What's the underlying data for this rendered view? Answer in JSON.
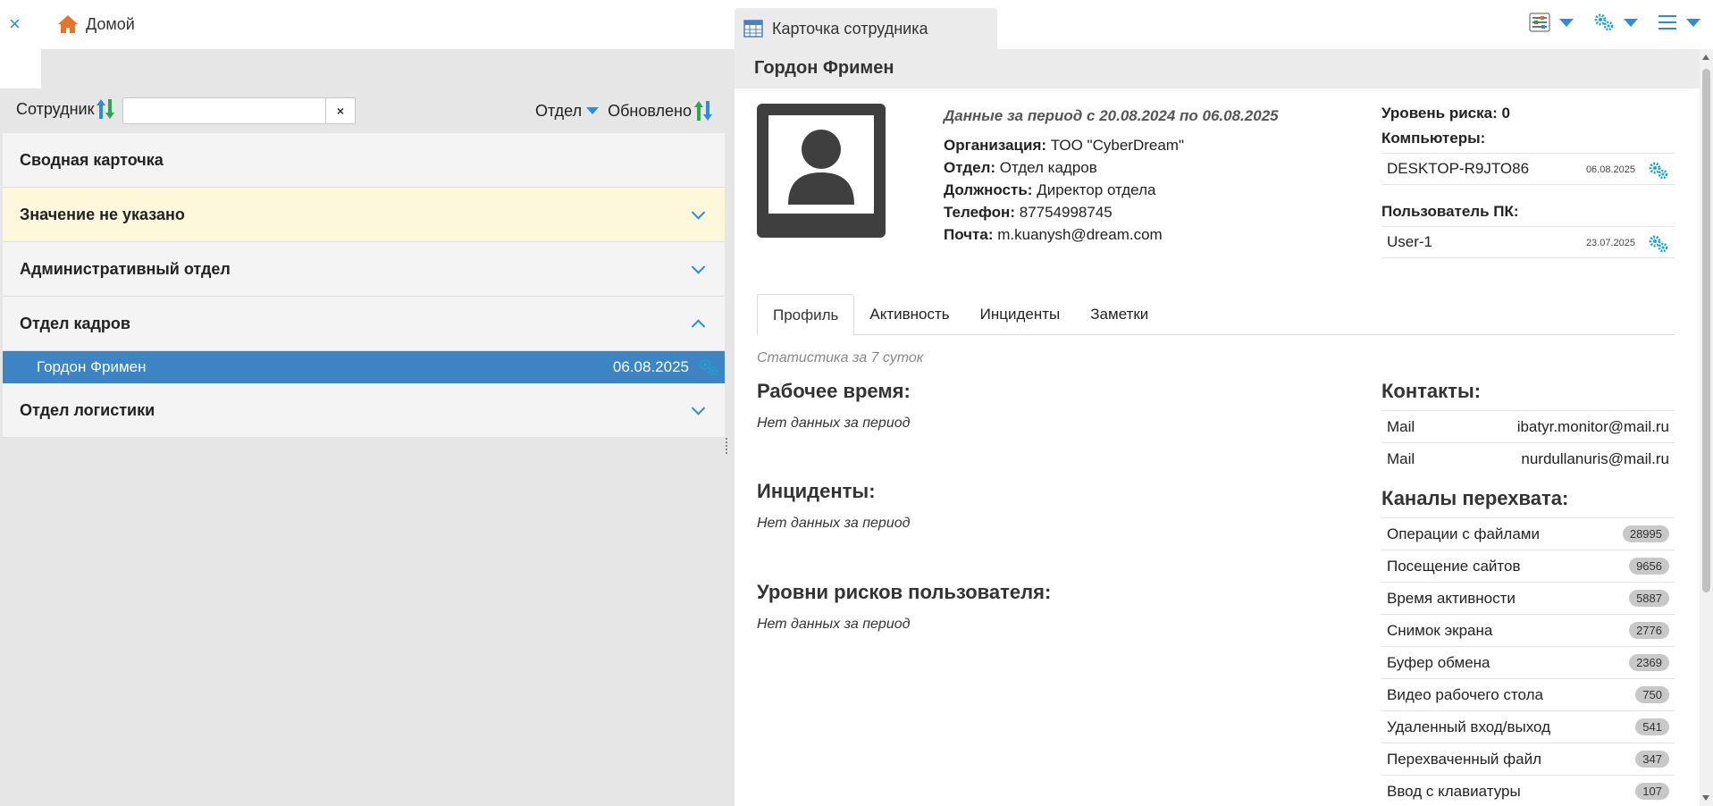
{
  "topbar": {
    "close_label": "×",
    "home_tab": "Домой",
    "card_tab": "Карточка сотрудника"
  },
  "filter": {
    "employee_label": "Сотрудник",
    "search_value": "",
    "clear_label": "×",
    "department_label": "Отдел",
    "updated_label": "Обновлено"
  },
  "list": {
    "summary": "Сводная карточка",
    "groups": [
      {
        "label": "Значение не указано"
      },
      {
        "label": "Административный отдел"
      },
      {
        "label": "Отдел кадров"
      },
      {
        "label": "Отдел логистики"
      }
    ],
    "selected": {
      "name": "Гордон Фримен",
      "date": "06.08.2025"
    }
  },
  "employee": {
    "header_name": "Гордон Фримен",
    "period": "Данные за период с 20.08.2024 по 06.08.2025",
    "org_label": "Организация:",
    "org_value": "ТОО \"CyberDream\"",
    "dept_label": "Отдел:",
    "dept_value": "Отдел кадров",
    "pos_label": "Должность:",
    "pos_value": "Директор отдела",
    "phone_label": "Телефон:",
    "phone_value": "87754998745",
    "mail_label": "Почта:",
    "mail_value": "m.kuanysh@dream.com",
    "risk_label": "Уровень риска: 0",
    "computers_label": "Компьютеры:",
    "computer": {
      "name": "DESKTOP-R9JTO86",
      "date": "06.08.2025"
    },
    "pc_user_label": "Пользователь ПК:",
    "pc_user": {
      "name": "User-1",
      "date": "23.07.2025"
    }
  },
  "tabs": [
    "Профиль",
    "Активность",
    "Инциденты",
    "Заметки"
  ],
  "profile": {
    "stat_note": "Статистика за 7 суток",
    "work_time": "Рабочее время:",
    "incidents": "Инциденты:",
    "risk_levels": "Уровни рисков пользователя:",
    "no_data": "Нет данных за период",
    "contacts_label": "Контакты:",
    "contacts": [
      {
        "type": "Mail",
        "value": "ibatyr.monitor@mail.ru"
      },
      {
        "type": "Mail",
        "value": "nurdullanuris@mail.ru"
      }
    ],
    "channels_label": "Каналы перехвата:",
    "channels": [
      {
        "name": "Операции с файлами",
        "count": "28995"
      },
      {
        "name": "Посещение сайтов",
        "count": "9656"
      },
      {
        "name": "Время активности",
        "count": "5887"
      },
      {
        "name": "Снимок экрана",
        "count": "2776"
      },
      {
        "name": "Буфер обмена",
        "count": "2369"
      },
      {
        "name": "Видео рабочего стола",
        "count": "750"
      },
      {
        "name": "Удаленный вход/выход",
        "count": "541"
      },
      {
        "name": "Перехваченный файл",
        "count": "347"
      },
      {
        "name": "Ввод с клавиатуры",
        "count": "107"
      }
    ]
  },
  "colors": {
    "accent": "#2a8fd6",
    "selected_row": "#3c84c4",
    "yellow_row": "#fdf7dc"
  }
}
